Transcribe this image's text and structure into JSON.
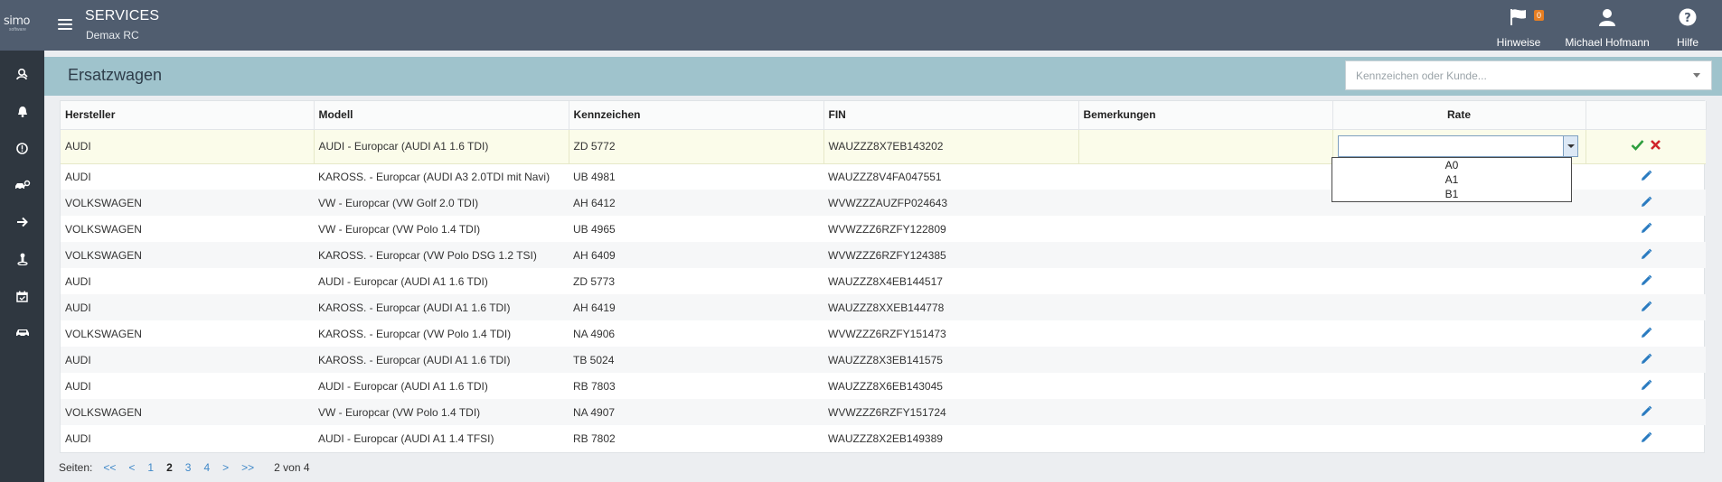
{
  "app": {
    "logo": "simo",
    "logo_sub": "software",
    "title": "SERVICES",
    "subtitle": "Demax RC"
  },
  "topnav": [
    {
      "label": "Hinweise",
      "icon": "flag-icon",
      "badge": "0"
    },
    {
      "label": "Michael Hofmann",
      "icon": "user-icon"
    },
    {
      "label": "Hilfe",
      "icon": "help-icon"
    }
  ],
  "sidebar": [
    {
      "icon": "user-search-icon"
    },
    {
      "icon": "bell-icon"
    },
    {
      "icon": "alert-icon"
    },
    {
      "icon": "car-key-icon"
    },
    {
      "icon": "arrow-right-icon"
    },
    {
      "icon": "person-pin-icon"
    },
    {
      "icon": "calendar-icon"
    },
    {
      "icon": "car-icon"
    }
  ],
  "page": {
    "title": "Ersatzwagen",
    "search_placeholder": "Kennzeichen oder Kunde..."
  },
  "table": {
    "columns": [
      "Hersteller",
      "Modell",
      "Kennzeichen",
      "FIN",
      "Bemerkungen",
      "Rate",
      ""
    ],
    "editing_row": {
      "hersteller": "AUDI",
      "modell": "AUDI - Europcar (AUDI A1 1.6 TDI)",
      "kennzeichen": "ZD 5772",
      "fin": "WAUZZZ8X7EB143202",
      "bemerkungen": "",
      "rate": ""
    },
    "rows": [
      {
        "hersteller": "AUDI",
        "modell": "KAROSS. - Europcar (AUDI A3 2.0TDI mit Navi)",
        "kennzeichen": "UB 4981",
        "fin": "WAUZZZ8V4FA047551",
        "bemerkungen": "",
        "rate": ""
      },
      {
        "hersteller": "VOLKSWAGEN",
        "modell": "VW - Europcar (VW Golf 2.0 TDI)",
        "kennzeichen": "AH 6412",
        "fin": "WVWZZZAUZFP024643",
        "bemerkungen": "",
        "rate": ""
      },
      {
        "hersteller": "VOLKSWAGEN",
        "modell": "VW - Europcar (VW Polo 1.4 TDI)",
        "kennzeichen": "UB 4965",
        "fin": "WVWZZZ6RZFY122809",
        "bemerkungen": "",
        "rate": ""
      },
      {
        "hersteller": "VOLKSWAGEN",
        "modell": "KAROSS. - Europcar (VW Polo DSG 1.2 TSI)",
        "kennzeichen": "AH 6409",
        "fin": "WVWZZZ6RZFY124385",
        "bemerkungen": "",
        "rate": ""
      },
      {
        "hersteller": "AUDI",
        "modell": "AUDI - Europcar (AUDI A1 1.6 TDI)",
        "kennzeichen": "ZD 5773",
        "fin": "WAUZZZ8X4EB144517",
        "bemerkungen": "",
        "rate": ""
      },
      {
        "hersteller": "AUDI",
        "modell": "KAROSS. - Europcar (AUDI A1 1.6 TDI)",
        "kennzeichen": "AH 6419",
        "fin": "WAUZZZ8XXEB144778",
        "bemerkungen": "",
        "rate": ""
      },
      {
        "hersteller": "VOLKSWAGEN",
        "modell": "KAROSS. - Europcar (VW Polo 1.4 TDI)",
        "kennzeichen": "NA 4906",
        "fin": "WVWZZZ6RZFY151473",
        "bemerkungen": "",
        "rate": ""
      },
      {
        "hersteller": "AUDI",
        "modell": "KAROSS. - Europcar (AUDI A1 1.6 TDI)",
        "kennzeichen": "TB 5024",
        "fin": "WAUZZZ8X3EB141575",
        "bemerkungen": "",
        "rate": ""
      },
      {
        "hersteller": "AUDI",
        "modell": "AUDI - Europcar (AUDI A1 1.6 TDI)",
        "kennzeichen": "RB 7803",
        "fin": "WAUZZZ8X6EB143045",
        "bemerkungen": "",
        "rate": ""
      },
      {
        "hersteller": "VOLKSWAGEN",
        "modell": "VW - Europcar (VW Polo 1.4 TDI)",
        "kennzeichen": "NA 4907",
        "fin": "WVWZZZ6RZFY151724",
        "bemerkungen": "",
        "rate": ""
      },
      {
        "hersteller": "AUDI",
        "modell": "AUDI - Europcar (AUDI A1 1.4 TFSI)",
        "kennzeichen": "RB 7802",
        "fin": "WAUZZZ8X2EB149389",
        "bemerkungen": "",
        "rate": ""
      }
    ]
  },
  "rate_options": [
    "A0",
    "A1",
    "B1"
  ],
  "pager": {
    "label": "Seiten:",
    "first": "<<",
    "prev": "<",
    "pages": [
      "1",
      "2",
      "3",
      "4"
    ],
    "current": "2",
    "next": ">",
    "last": ">>",
    "summary": "2 von 4"
  },
  "colors": {
    "topbar": "#505d6f",
    "sidebar": "#2f3740",
    "header": "#9fc3cc",
    "link": "#3f88c8",
    "confirm": "#2e9e3e",
    "cancel": "#d0242a",
    "edit_row": "#fbfcea"
  }
}
